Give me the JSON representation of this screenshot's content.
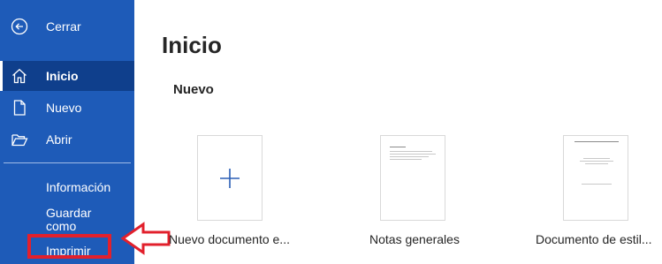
{
  "sidebar": {
    "back_label": "Cerrar",
    "items": [
      {
        "label": "Inicio",
        "icon": "home-icon"
      },
      {
        "label": "Nuevo",
        "icon": "new-document-icon"
      },
      {
        "label": "Abrir",
        "icon": "folder-open-icon"
      }
    ],
    "secondary": [
      "Información",
      "Guardar",
      "como",
      "Imprimir"
    ]
  },
  "main": {
    "title": "Inicio",
    "section_title": "Nuevo",
    "templates": [
      {
        "label": "Nuevo documento e...",
        "icon": "plus-icon"
      },
      {
        "label": "Notas generales"
      },
      {
        "label": "Documento de estil..."
      }
    ]
  },
  "colors": {
    "sidebar_bg": "#1e5bb8",
    "sidebar_active": "#0f3f8c",
    "highlight": "#e2202c",
    "plus": "#2b5fb5"
  }
}
